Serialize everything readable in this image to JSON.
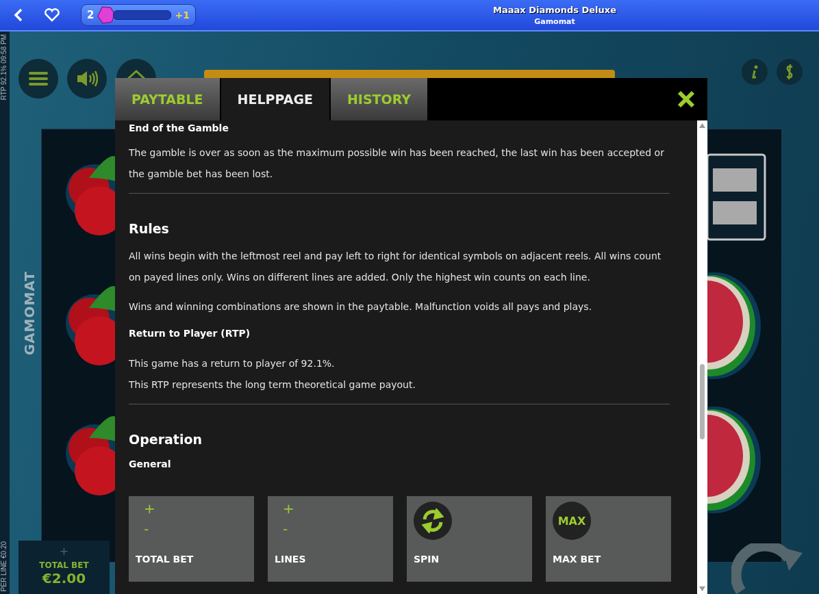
{
  "top_bar": {
    "level_badge": {
      "number": "2",
      "reward": "+1"
    },
    "title": "Maaax Diamonds Deluxe",
    "subtitle": "Gamomat"
  },
  "side_info": {
    "top": "RTP 92.1% 09:58 PM",
    "bottom": "PER LINE €0.20"
  },
  "reel_brand": "GAMOMAT",
  "total_bet": {
    "increase": "+",
    "label": "TOTAL BET",
    "value": "€2.00"
  },
  "modal": {
    "tabs": [
      {
        "label": "PAYTABLE",
        "selected": false
      },
      {
        "label": "HELPPAGE",
        "selected": true
      },
      {
        "label": "HISTORY",
        "selected": false
      }
    ],
    "sections": [
      {
        "kind": "subheading",
        "text": "End of the Gamble"
      },
      {
        "kind": "paragraph",
        "text": "The gamble is over as soon as the maximum possible win has been reached, the last win has been accepted or the gamble bet has been lost."
      },
      {
        "kind": "divider"
      },
      {
        "kind": "heading",
        "text": "Rules"
      },
      {
        "kind": "paragraph",
        "text": "All wins begin with the leftmost reel and pay left to right for identical symbols on adjacent reels. All wins count on payed lines only. Wins on different lines are added. Only the highest win counts on each line."
      },
      {
        "kind": "paragraph",
        "text": "Wins and winning combinations are shown in the paytable. Malfunction voids all pays and plays."
      },
      {
        "kind": "subheading",
        "text": "Return to Player (RTP)"
      },
      {
        "kind": "line",
        "text": "This game has a return to player of 92.1%."
      },
      {
        "kind": "line",
        "text": "This RTP represents the long term theoretical game payout."
      },
      {
        "kind": "divider"
      },
      {
        "kind": "heading",
        "text": "Operation"
      },
      {
        "kind": "subheading",
        "text": "General"
      }
    ],
    "controls": [
      {
        "kind": "stepper",
        "plus": "+",
        "minus": "-",
        "label": "TOTAL BET"
      },
      {
        "kind": "stepper",
        "plus": "+",
        "minus": "-",
        "label": "LINES"
      },
      {
        "kind": "spin",
        "label": "SPIN"
      },
      {
        "kind": "max",
        "badge": "MAX",
        "label": "MAX BET"
      }
    ]
  }
}
